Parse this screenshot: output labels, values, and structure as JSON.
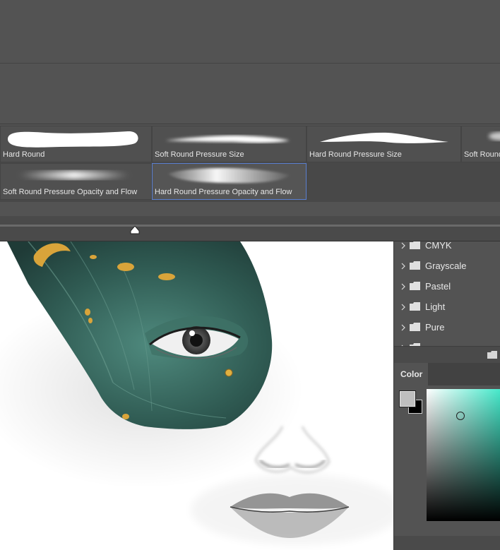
{
  "brushes": [
    {
      "label": "Hard Round"
    },
    {
      "label": "Soft Round Pressure Size"
    },
    {
      "label": "Hard Round Pressure Size"
    },
    {
      "label": "Soft Round"
    },
    {
      "label": "Soft Round Pressure Opacity and Flow"
    },
    {
      "label": "Hard Round Pressure Opacity and Flow",
      "selected": true
    }
  ],
  "swatches": {
    "groups": [
      "CMYK",
      "Grayscale",
      "Pastel",
      "Light",
      "Pure"
    ]
  },
  "color_panel": {
    "tab_label": "Color",
    "foreground_color": "#bfbfbf",
    "background_color": "#000000",
    "hue_color": "#3ce8c8"
  },
  "colors": {
    "panel_bg": "#535353",
    "selection_border": "#5a7fd0"
  }
}
